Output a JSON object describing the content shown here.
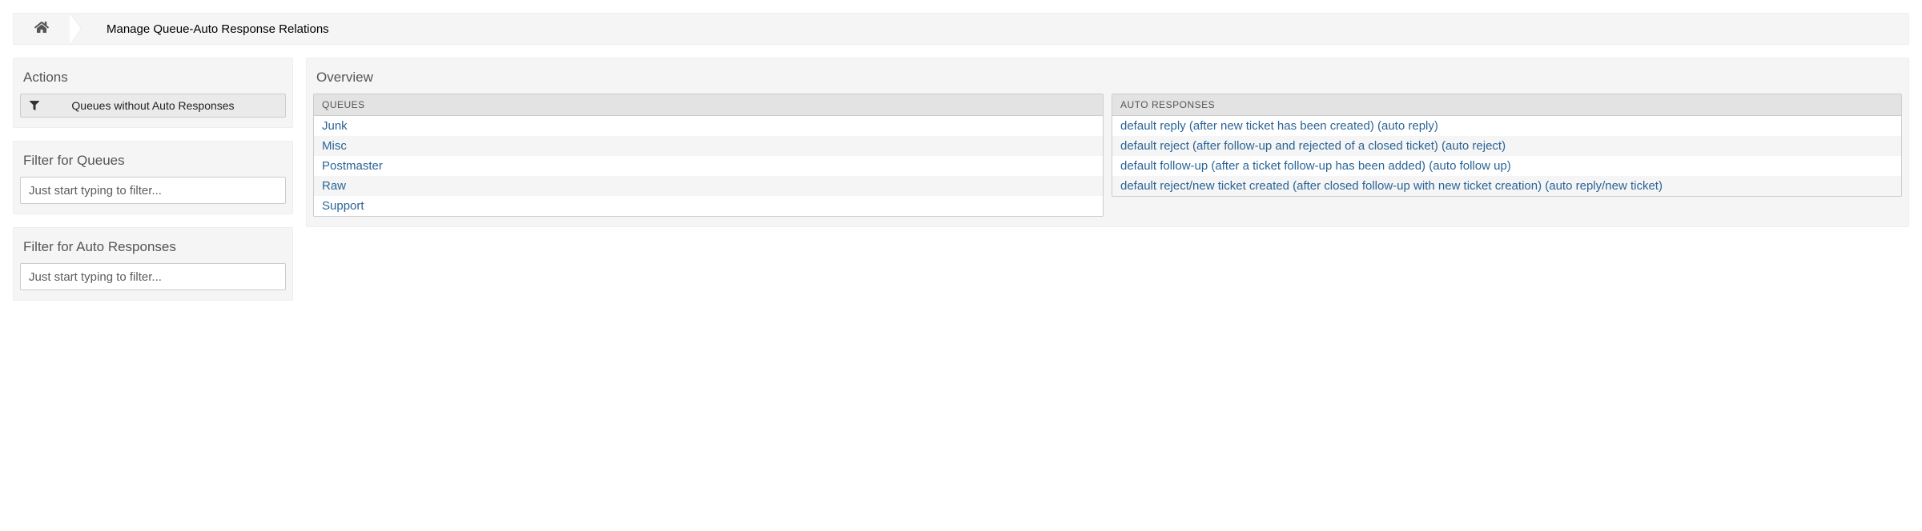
{
  "breadcrumb": {
    "title": "Manage Queue-Auto Response Relations"
  },
  "sidebar": {
    "actions_header": "Actions",
    "actions": {
      "queues_without": "Queues without Auto Responses"
    },
    "filter_queues_header": "Filter for Queues",
    "filter_queues_placeholder": "Just start typing to filter...",
    "filter_auto_header": "Filter for Auto Responses",
    "filter_auto_placeholder": "Just start typing to filter..."
  },
  "overview": {
    "header": "Overview",
    "queues_col": "QUEUES",
    "auto_col": "AUTO RESPONSES",
    "queues": [
      "Junk",
      "Misc",
      "Postmaster",
      "Raw",
      "Support"
    ],
    "auto_responses": [
      "default reply (after new ticket has been created) (auto reply)",
      "default reject (after follow-up and rejected of a closed ticket) (auto reject)",
      "default follow-up (after a ticket follow-up has been added) (auto follow up)",
      "default reject/new ticket created (after closed follow-up with new ticket creation) (auto reply/new ticket)"
    ]
  }
}
